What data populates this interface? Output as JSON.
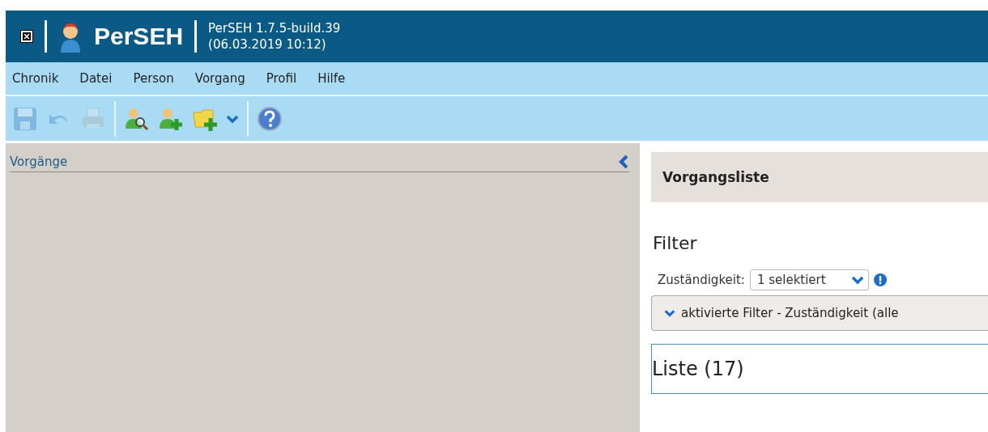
{
  "header": {
    "app_name": "PerSEH",
    "version": "PerSEH 1.7.5-build.39",
    "build_date": "(06.03.2019 10:12)"
  },
  "menu": [
    "Chronik",
    "Datei",
    "Person",
    "Vorgang",
    "Profil",
    "Hilfe"
  ],
  "toolbar": [
    {
      "tools": [
        {
          "kind": "save",
          "disabled": true
        },
        {
          "kind": "undo",
          "disabled": true
        },
        {
          "kind": "print",
          "disabled": true
        }
      ]
    },
    {
      "tools": [
        {
          "kind": "person-search",
          "disabled": false
        },
        {
          "kind": "person-add",
          "disabled": false
        },
        {
          "kind": "folder-add",
          "disabled": false
        },
        {
          "kind": "dropdown",
          "disabled": false
        }
      ]
    },
    {
      "tools": [
        {
          "kind": "help",
          "disabled": false
        }
      ]
    }
  ],
  "left_panel": {
    "title": "Vorgänge"
  },
  "right_panel": {
    "title": "Vorgangsliste",
    "filter_heading": "Filter",
    "filter_label": "Zuständigkeit:",
    "filter_value": "1 selektiert",
    "active_filters": "aktivierte Filter - Zuständigkeit (alle",
    "list_heading": "Liste (17)"
  }
}
